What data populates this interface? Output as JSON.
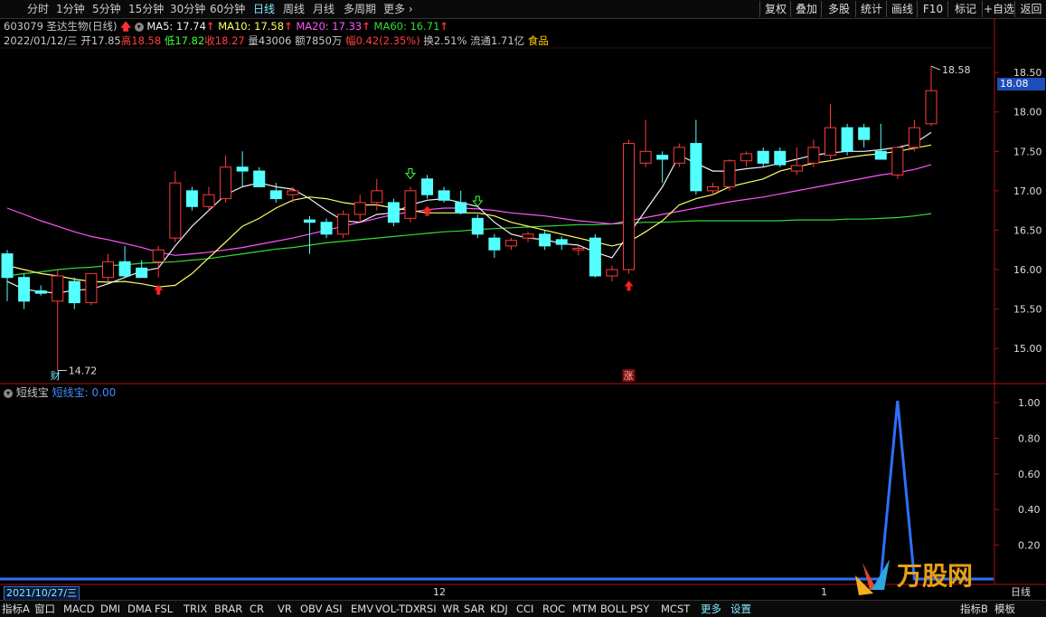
{
  "toolbar": {
    "timeframes": [
      "分时",
      "1分钟",
      "5分钟",
      "15分钟",
      "30分钟",
      "60分钟",
      "日线",
      "周线",
      "月线",
      "多周期",
      "更多"
    ],
    "active_timeframe": "日线",
    "right_buttons": [
      "复权",
      "叠加",
      "多股",
      "统计",
      "画线",
      "F10",
      "标记",
      "+自选",
      "返回"
    ]
  },
  "stock": {
    "code_name": "603079 圣达生物(日线)",
    "ma5_label": "MA5: 17.74",
    "ma10_label": "MA10: 17.58",
    "ma20_label": "MA20: 17.33",
    "ma60_label": "MA60: 16.71",
    "date": "2022/01/12/三",
    "open": "开17.85",
    "high": "高18.58",
    "low": "低17.82",
    "close": "收18.27",
    "volume": "量43006",
    "amount": "额7850万",
    "change": "幅0.42(2.35%)",
    "turnover": "换2.51%",
    "float_cap": "流通1.71亿",
    "sector": "食品"
  },
  "price_axis": {
    "ticks": [
      "18.50",
      "18.00",
      "17.50",
      "17.00",
      "16.50",
      "16.00",
      "15.50",
      "15.00"
    ],
    "current_price": "18.08",
    "high_marker": "18.58",
    "low_marker": "14.72"
  },
  "markers": {
    "cai": "财",
    "zhang": "涨"
  },
  "indicator": {
    "name": "短线宝",
    "value_label": "短线宝: 0.00",
    "ticks": [
      "1.00",
      "0.80",
      "0.60",
      "0.40",
      "0.20"
    ]
  },
  "time_axis": {
    "start_date": "2021/10/27/三",
    "labels": [
      "12",
      "1"
    ],
    "period_label": "日线"
  },
  "bottom_tabs": [
    "指标A",
    "窗口",
    "MACD",
    "DMI",
    "DMA",
    "FSL",
    "TRIX",
    "BRAR",
    "CR",
    "VR",
    "OBV",
    "ASI",
    "EMV",
    "VOL-TDX",
    "RSI",
    "WR",
    "SAR",
    "KDJ",
    "CCI",
    "ROC",
    "MTM",
    "BOLL",
    "PSY",
    "MCST",
    "更多",
    "设置"
  ],
  "bottom_right": [
    "指标B",
    "模板"
  ],
  "watermark": "万股网",
  "colors": {
    "up": "#ff3b3b",
    "down": "#54ffff",
    "ma5": "#f0f0f0",
    "ma10": "#ffff66",
    "ma20": "#ff55ff",
    "ma60": "#33dd33",
    "indicator": "#2f6fff",
    "axis": "#b01010"
  },
  "chart_data": {
    "type": "candlestick",
    "y_range": [
      14.6,
      18.8
    ],
    "candles": [
      {
        "o": 16.2,
        "h": 16.25,
        "l": 15.6,
        "c": 15.9
      },
      {
        "o": 15.9,
        "h": 15.95,
        "l": 15.5,
        "c": 15.6
      },
      {
        "o": 15.73,
        "h": 15.8,
        "l": 15.67,
        "c": 15.7
      },
      {
        "o": 15.6,
        "h": 16.0,
        "l": 14.72,
        "c": 15.92
      },
      {
        "o": 15.85,
        "h": 15.9,
        "l": 15.5,
        "c": 15.58
      },
      {
        "o": 15.58,
        "h": 15.95,
        "l": 15.55,
        "c": 15.95
      },
      {
        "o": 15.9,
        "h": 16.2,
        "l": 15.85,
        "c": 16.1
      },
      {
        "o": 16.1,
        "h": 16.3,
        "l": 15.9,
        "c": 15.92
      },
      {
        "o": 16.02,
        "h": 16.12,
        "l": 15.9,
        "c": 15.9
      },
      {
        "o": 16.1,
        "h": 16.3,
        "l": 15.9,
        "c": 16.25
      },
      {
        "o": 16.4,
        "h": 17.25,
        "l": 16.35,
        "c": 17.1
      },
      {
        "o": 17.0,
        "h": 17.05,
        "l": 16.75,
        "c": 16.8
      },
      {
        "o": 16.8,
        "h": 17.05,
        "l": 16.75,
        "c": 16.95
      },
      {
        "o": 16.9,
        "h": 17.45,
        "l": 16.85,
        "c": 17.3
      },
      {
        "o": 17.3,
        "h": 17.5,
        "l": 17.05,
        "c": 17.25
      },
      {
        "o": 17.25,
        "h": 17.3,
        "l": 17.05,
        "c": 17.05
      },
      {
        "o": 17.0,
        "h": 17.1,
        "l": 16.85,
        "c": 16.9
      },
      {
        "o": 16.95,
        "h": 17.05,
        "l": 16.85,
        "c": 17.0
      },
      {
        "o": 16.63,
        "h": 16.68,
        "l": 16.2,
        "c": 16.6
      },
      {
        "o": 16.6,
        "h": 16.65,
        "l": 16.4,
        "c": 16.45
      },
      {
        "o": 16.45,
        "h": 16.75,
        "l": 16.4,
        "c": 16.7
      },
      {
        "o": 16.7,
        "h": 16.95,
        "l": 16.6,
        "c": 16.85
      },
      {
        "o": 16.85,
        "h": 17.15,
        "l": 16.75,
        "c": 17.0
      },
      {
        "o": 16.85,
        "h": 16.9,
        "l": 16.55,
        "c": 16.6
      },
      {
        "o": 16.65,
        "h": 17.05,
        "l": 16.6,
        "c": 17.0
      },
      {
        "o": 17.15,
        "h": 17.2,
        "l": 16.9,
        "c": 16.95
      },
      {
        "o": 17.0,
        "h": 17.05,
        "l": 16.85,
        "c": 16.88
      },
      {
        "o": 16.85,
        "h": 17.0,
        "l": 16.7,
        "c": 16.72
      },
      {
        "o": 16.65,
        "h": 16.7,
        "l": 16.4,
        "c": 16.45
      },
      {
        "o": 16.4,
        "h": 16.45,
        "l": 16.15,
        "c": 16.25
      },
      {
        "o": 16.3,
        "h": 16.4,
        "l": 16.25,
        "c": 16.37
      },
      {
        "o": 16.4,
        "h": 16.48,
        "l": 16.35,
        "c": 16.45
      },
      {
        "o": 16.45,
        "h": 16.5,
        "l": 16.25,
        "c": 16.3
      },
      {
        "o": 16.38,
        "h": 16.42,
        "l": 16.25,
        "c": 16.32
      },
      {
        "o": 16.25,
        "h": 16.3,
        "l": 16.18,
        "c": 16.27
      },
      {
        "o": 16.4,
        "h": 16.45,
        "l": 15.9,
        "c": 15.92
      },
      {
        "o": 15.92,
        "h": 16.05,
        "l": 15.85,
        "c": 16.0
      },
      {
        "o": 16.0,
        "h": 17.65,
        "l": 15.95,
        "c": 17.6
      },
      {
        "o": 17.35,
        "h": 17.9,
        "l": 17.3,
        "c": 17.5
      },
      {
        "o": 17.45,
        "h": 17.5,
        "l": 17.1,
        "c": 17.4
      },
      {
        "o": 17.35,
        "h": 17.6,
        "l": 17.3,
        "c": 17.55
      },
      {
        "o": 17.6,
        "h": 17.9,
        "l": 16.95,
        "c": 17.0
      },
      {
        "o": 17.0,
        "h": 17.1,
        "l": 16.95,
        "c": 17.05
      },
      {
        "o": 17.05,
        "h": 17.4,
        "l": 17.0,
        "c": 17.38
      },
      {
        "o": 17.38,
        "h": 17.5,
        "l": 17.3,
        "c": 17.47
      },
      {
        "o": 17.5,
        "h": 17.55,
        "l": 17.3,
        "c": 17.35
      },
      {
        "o": 17.5,
        "h": 17.55,
        "l": 17.3,
        "c": 17.33
      },
      {
        "o": 17.25,
        "h": 17.55,
        "l": 17.2,
        "c": 17.32
      },
      {
        "o": 17.35,
        "h": 17.65,
        "l": 17.3,
        "c": 17.55
      },
      {
        "o": 17.45,
        "h": 18.1,
        "l": 17.4,
        "c": 17.8
      },
      {
        "o": 17.8,
        "h": 17.85,
        "l": 17.45,
        "c": 17.5
      },
      {
        "o": 17.8,
        "h": 17.85,
        "l": 17.55,
        "c": 17.65
      },
      {
        "o": 17.5,
        "h": 17.85,
        "l": 17.4,
        "c": 17.4
      },
      {
        "o": 17.2,
        "h": 17.55,
        "l": 17.15,
        "c": 17.55
      },
      {
        "o": 17.55,
        "h": 17.9,
        "l": 17.5,
        "c": 17.8
      },
      {
        "o": 17.85,
        "h": 18.58,
        "l": 17.82,
        "c": 18.27
      }
    ],
    "ma5": [
      15.85,
      15.75,
      15.72,
      15.7,
      15.74,
      15.75,
      15.82,
      15.9,
      15.98,
      16.02,
      16.3,
      16.55,
      16.75,
      16.95,
      17.05,
      17.1,
      17.05,
      17.02,
      16.9,
      16.75,
      16.62,
      16.6,
      16.7,
      16.72,
      16.82,
      16.88,
      16.9,
      16.85,
      16.8,
      16.6,
      16.45,
      16.4,
      16.38,
      16.33,
      16.31,
      16.22,
      16.15,
      16.45,
      16.75,
      17.05,
      17.45,
      17.35,
      17.25,
      17.25,
      17.28,
      17.3,
      17.35,
      17.4,
      17.45,
      17.48,
      17.5,
      17.5,
      17.52,
      17.55,
      17.6,
      17.74
    ],
    "ma10": [
      16.05,
      16.0,
      15.95,
      15.92,
      15.88,
      15.85,
      15.84,
      15.85,
      15.82,
      15.78,
      15.8,
      15.95,
      16.15,
      16.35,
      16.55,
      16.65,
      16.78,
      16.88,
      16.92,
      16.9,
      16.85,
      16.82,
      16.82,
      16.78,
      16.75,
      16.72,
      16.72,
      16.72,
      16.72,
      16.68,
      16.6,
      16.55,
      16.5,
      16.45,
      16.4,
      16.35,
      16.3,
      16.35,
      16.48,
      16.62,
      16.82,
      16.9,
      16.95,
      17.05,
      17.1,
      17.15,
      17.25,
      17.3,
      17.35,
      17.38,
      17.42,
      17.45,
      17.47,
      17.5,
      17.54,
      17.58
    ],
    "ma20": [
      16.78,
      16.7,
      16.62,
      16.55,
      16.48,
      16.42,
      16.38,
      16.33,
      16.28,
      16.22,
      16.18,
      16.2,
      16.22,
      16.25,
      16.28,
      16.32,
      16.36,
      16.4,
      16.45,
      16.5,
      16.55,
      16.6,
      16.65,
      16.7,
      16.73,
      16.76,
      16.78,
      16.78,
      16.77,
      16.75,
      16.72,
      16.7,
      16.68,
      16.65,
      16.62,
      16.6,
      16.58,
      16.62,
      16.66,
      16.7,
      16.74,
      16.78,
      16.82,
      16.86,
      16.89,
      16.92,
      16.96,
      17.0,
      17.04,
      17.08,
      17.12,
      17.16,
      17.2,
      17.23,
      17.27,
      17.33
    ],
    "ma60": [
      15.92,
      15.95,
      15.97,
      16.0,
      16.02,
      16.03,
      16.05,
      16.06,
      16.08,
      16.09,
      16.1,
      16.12,
      16.14,
      16.17,
      16.2,
      16.23,
      16.26,
      16.28,
      16.31,
      16.34,
      16.36,
      16.38,
      16.4,
      16.42,
      16.44,
      16.46,
      16.48,
      16.49,
      16.51,
      16.52,
      16.53,
      16.54,
      16.55,
      16.56,
      16.57,
      16.57,
      16.58,
      16.59,
      16.6,
      16.6,
      16.61,
      16.62,
      16.62,
      16.62,
      16.62,
      16.62,
      16.62,
      16.63,
      16.63,
      16.63,
      16.64,
      16.64,
      16.65,
      16.66,
      16.68,
      16.71
    ],
    "up_signals": [
      9,
      25,
      37
    ],
    "down_signals": [
      24,
      28
    ],
    "indicator_values": [
      0,
      0,
      0,
      0,
      0,
      0,
      0,
      0,
      0,
      0,
      0,
      0,
      0,
      0,
      0,
      0,
      0,
      0,
      0,
      0,
      0,
      0,
      0,
      0,
      0,
      0,
      0,
      0,
      0,
      0,
      0,
      0,
      0,
      0,
      0,
      0,
      0,
      0,
      0,
      0,
      0,
      0,
      0,
      0,
      0,
      0,
      0,
      0,
      0,
      0,
      0,
      0,
      0,
      1,
      0,
      0
    ],
    "indicator_range": [
      0,
      1.1
    ]
  }
}
